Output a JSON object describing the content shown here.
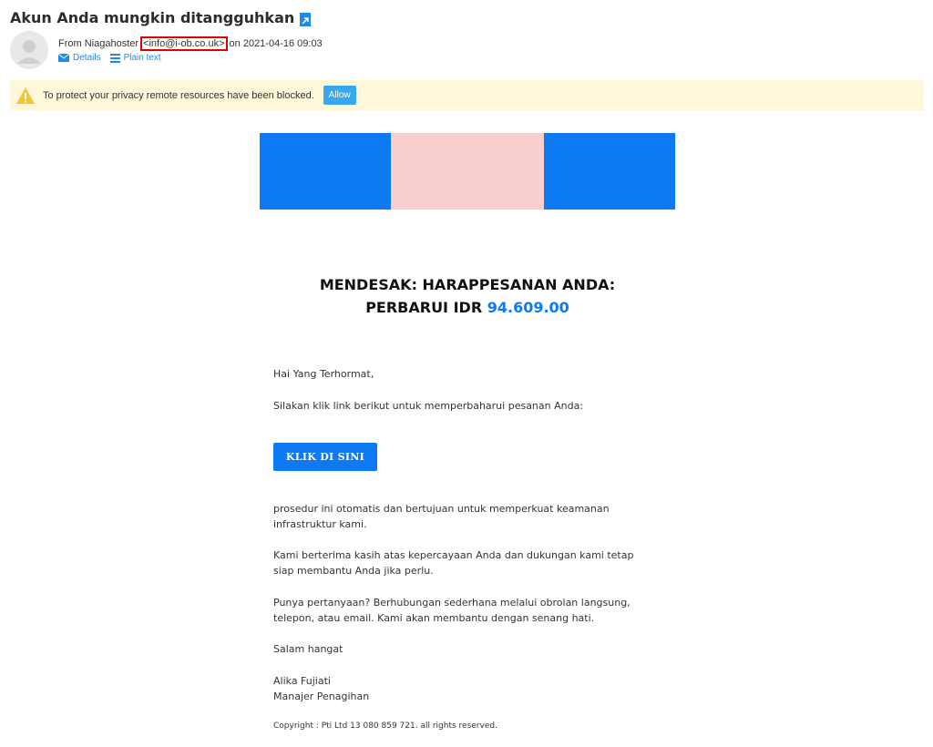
{
  "email": {
    "subject": "Akun Anda mungkin ditangguhkan",
    "from_prefix": "From",
    "from_name": "Niagahoster",
    "from_address": "<info@i-ob.co.uk>",
    "date_prefix": "on",
    "date": "2021-04-16 09:03",
    "details_label": "Details",
    "plain_text_label": "Plain text"
  },
  "privacy_bar": {
    "message": "To protect your privacy remote resources have been blocked.",
    "allow_label": "Allow"
  },
  "banner": {
    "colors": [
      "#0d79f2",
      "#f9cfcf",
      "#0d79f2"
    ]
  },
  "content": {
    "headline_line1": "MENDESAK: HARAPPESANAN ANDA:",
    "headline_line2_prefix": "PERBARUI IDR",
    "headline_amount": "94.609.00",
    "greeting": "Hai Yang Terhormat,",
    "instruction": "Silakan klik link berikut untuk memperbaharui pesanan Anda:",
    "cta_label": "KLIK DI SINI",
    "para1_line1": "prosedur ini otomatis dan bertujuan untuk memperkuat keamanan",
    "para1_line2": "infrastruktur kami.",
    "para2_line1": "Kami berterima kasih atas kepercayaan Anda dan dukungan kami tetap",
    "para2_line2": "siap membantu Anda jika perlu.",
    "para3_line1": "Punya pertanyaan? Berhubungan sederhana melalui obrolan langsung,",
    "para3_line2": "telepon, atau email. Kami akan membantu dengan senang hati.",
    "closing": "Salam hangat",
    "signer_name": "Alika Fujiati",
    "signer_title": "Manajer Penagihan",
    "copyright": "Copyright : Pti Ltd 13 080 859 721. all rights reserved."
  },
  "colors": {
    "accent": "#0d79f2",
    "link": "#1c8ce8",
    "warning_bg": "#fef7d9",
    "highlight_box": "#e00000"
  }
}
